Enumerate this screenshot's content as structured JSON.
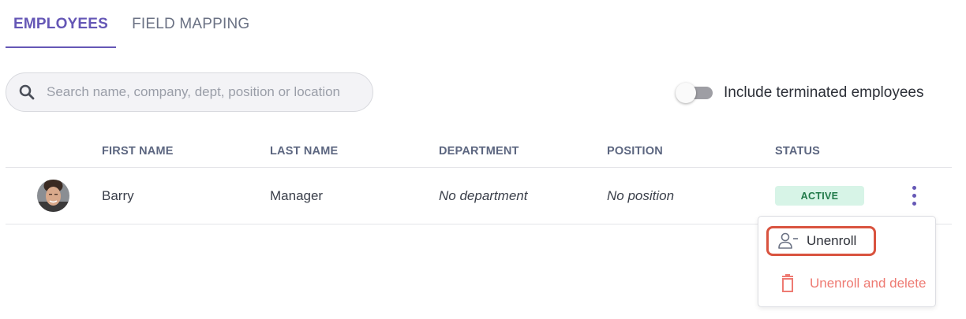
{
  "tabs": [
    {
      "label": "EMPLOYEES",
      "active": true
    },
    {
      "label": "FIELD MAPPING",
      "active": false
    }
  ],
  "search": {
    "placeholder": "Search name, company, dept, position or location",
    "value": ""
  },
  "toggle": {
    "label": "Include terminated employees",
    "on": false
  },
  "table": {
    "columns": [
      "FIRST NAME",
      "LAST NAME",
      "DEPARTMENT",
      "POSITION",
      "STATUS"
    ],
    "rows": [
      {
        "first_name": "Barry",
        "last_name": "Manager",
        "department": "No department",
        "position": "No position",
        "status": "ACTIVE"
      }
    ]
  },
  "row_menu": {
    "items": [
      {
        "label": "Unenroll",
        "icon": "user-minus-icon"
      },
      {
        "label": "Unenroll and delete",
        "icon": "trash-icon"
      }
    ]
  },
  "colors": {
    "accent": "#6557b6",
    "active_badge_bg": "#d7f4e7",
    "active_badge_text": "#217a4a",
    "danger": "#ee7a72",
    "highlight_border": "#d9533f"
  }
}
